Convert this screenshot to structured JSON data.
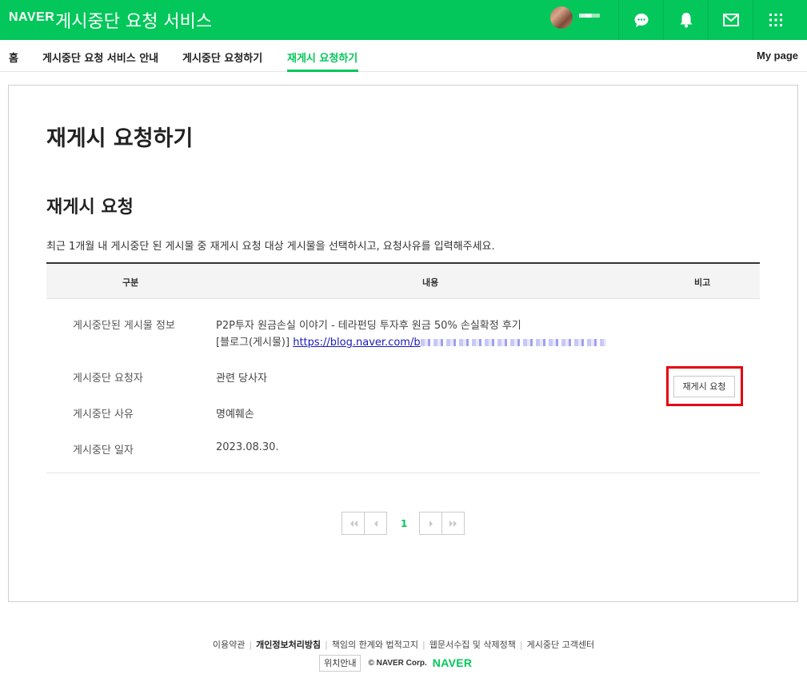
{
  "header": {
    "logo": "NAVER",
    "service_title": "게시중단 요청 서비스",
    "icons": [
      "talk-icon",
      "bell-icon",
      "mail-icon",
      "apps-icon"
    ],
    "accent_color": "#03c75a"
  },
  "nav": {
    "items": [
      {
        "label": "홈"
      },
      {
        "label": "게시중단 요청 서비스 안내"
      },
      {
        "label": "게시중단 요청하기"
      },
      {
        "label": "재게시 요청하기",
        "active": true
      }
    ],
    "mypage": "My page"
  },
  "main": {
    "page_title": "재게시 요청하기",
    "section_title": "재게시 요청",
    "description": "최근 1개월 내 게시중단 된 게시물 중 재게시 요청 대상 게시물을 선택하시고, 요청사유를 입력해주세요.",
    "table": {
      "headers": [
        "구분",
        "내용",
        "비고"
      ],
      "rows": [
        {
          "label": "게시중단된 게시물 정보",
          "value": "P2P투자 원금손실 이야기 - 테라펀딩 투자후 원금 50% 손실확정 후기",
          "value2_prefix": "[블로그(게시물)]",
          "link": "https://blog.naver.com/b"
        },
        {
          "label": "게시중단 요청자",
          "value": "관련 당사자"
        },
        {
          "label": "게시중단 사유",
          "value": "명예훼손"
        },
        {
          "label": "게시중단 일자",
          "value": "2023.08.30."
        }
      ],
      "action_button": "재게시 요청"
    },
    "pagination": {
      "current": "1"
    }
  },
  "footer": {
    "links": [
      "이용약관",
      "개인정보처리방침",
      "책임의 한계와 법적고지",
      "웹문서수집 및 삭제정책",
      "게시중단 고객센터"
    ],
    "location_button": "위치안내",
    "copyright": "© NAVER Corp.",
    "logo": "NAVER"
  }
}
